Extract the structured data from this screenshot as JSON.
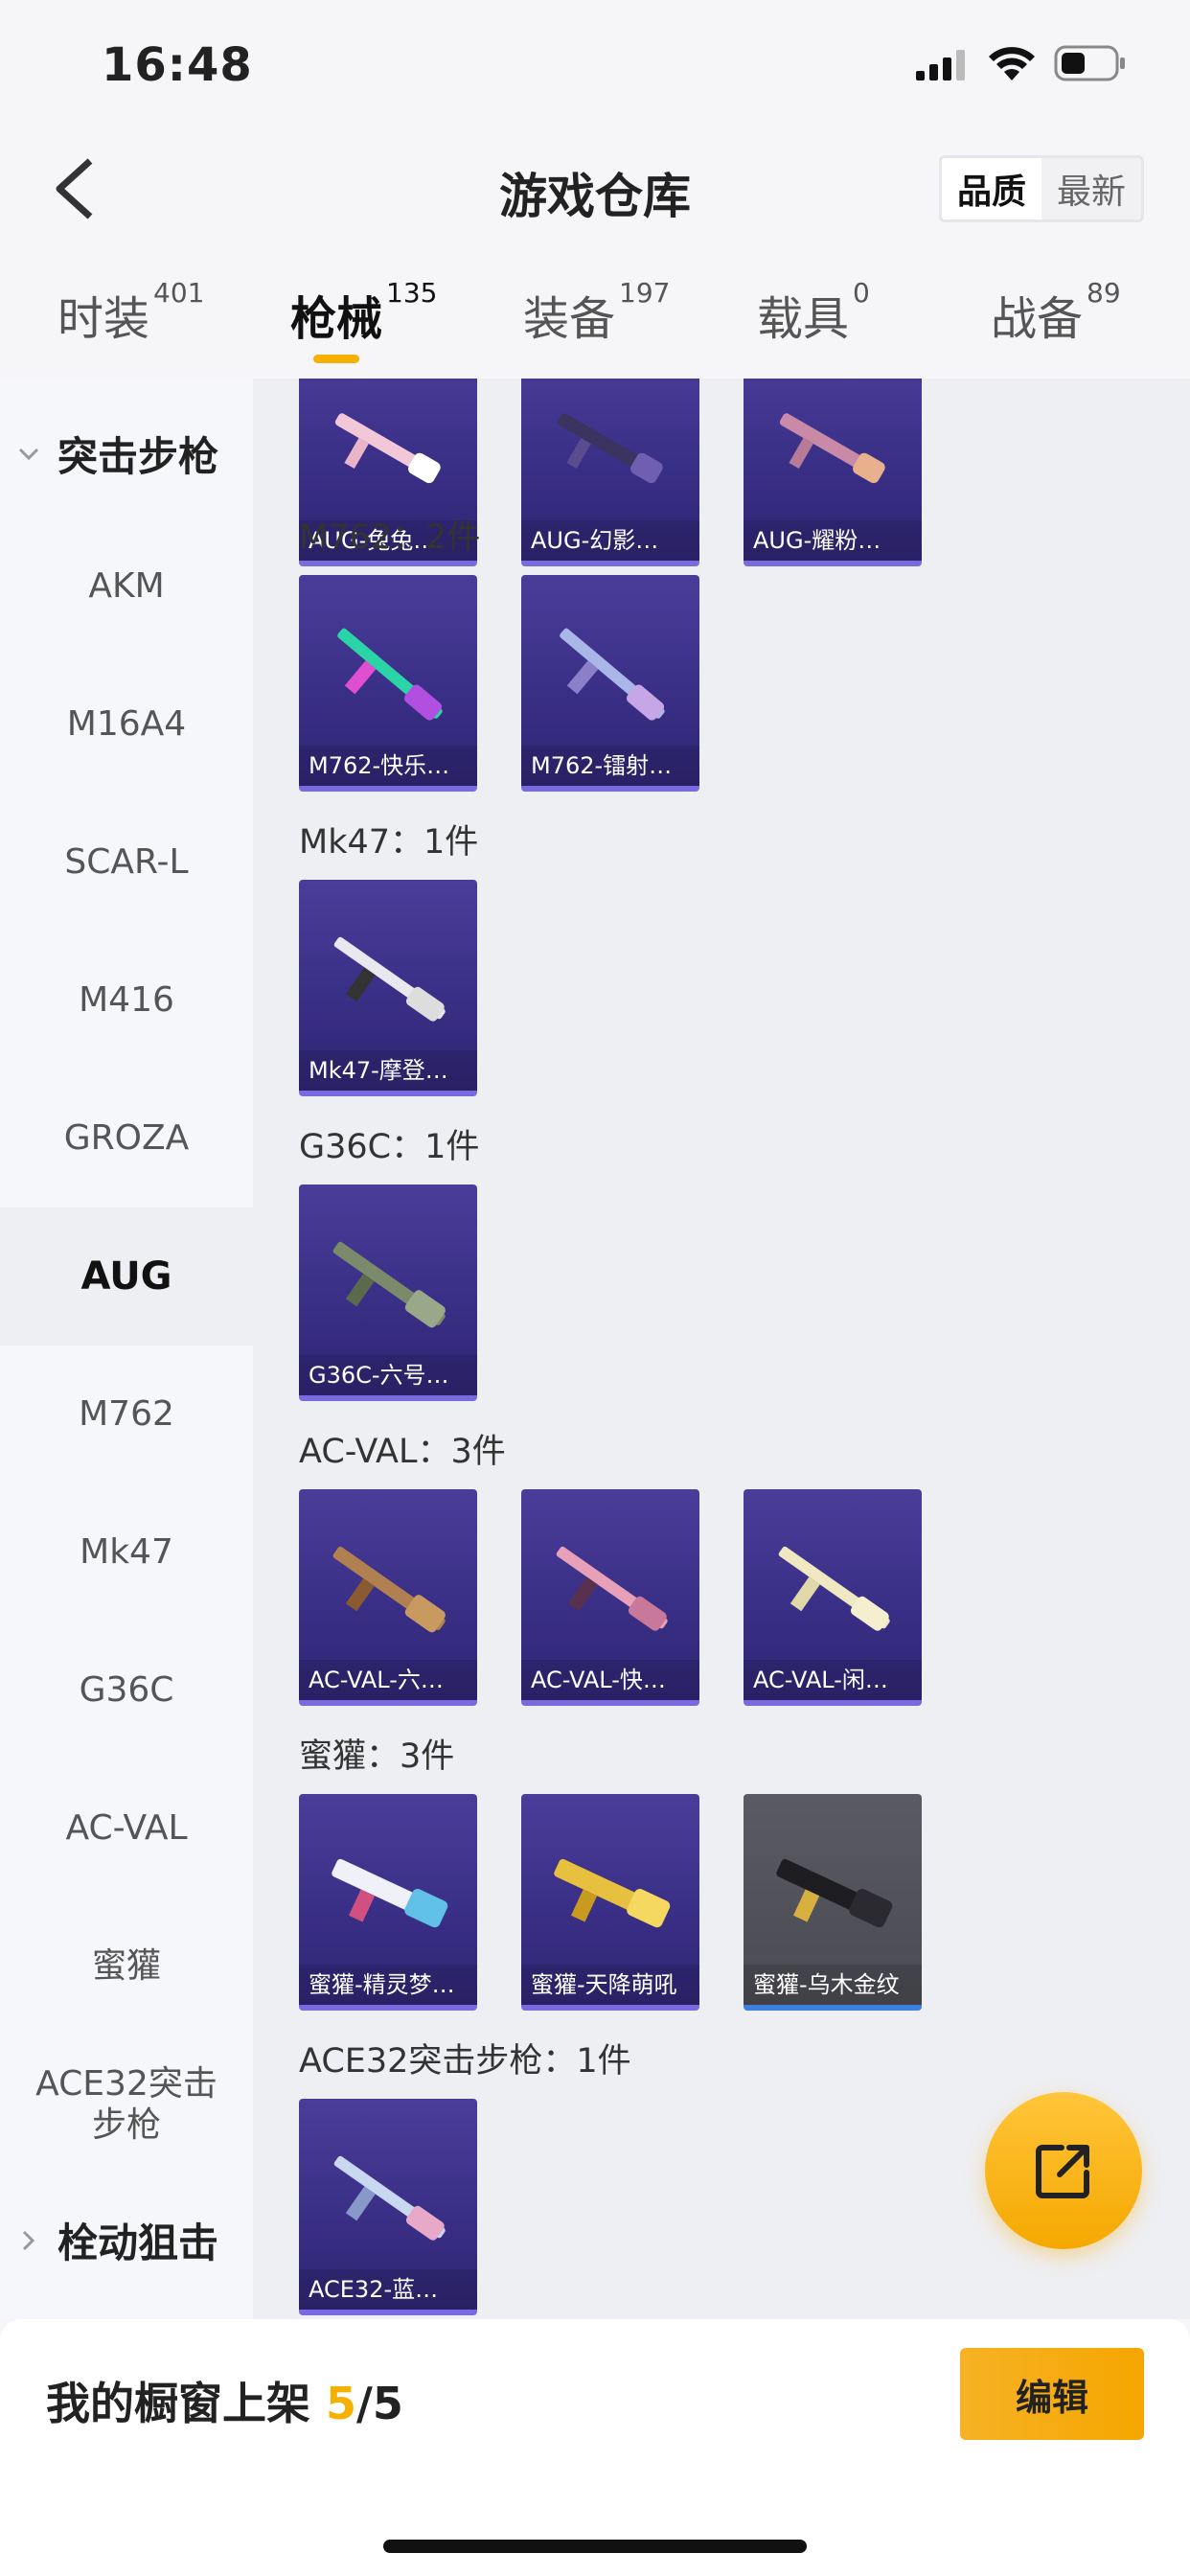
{
  "status": {
    "time": "16:48"
  },
  "header": {
    "title": "游戏仓库",
    "sort_quality": "品质",
    "sort_newest": "最新"
  },
  "tabs": [
    {
      "label": "时装",
      "count": "401"
    },
    {
      "label": "枪械",
      "count": "135"
    },
    {
      "label": "装备",
      "count": "197"
    },
    {
      "label": "载具",
      "count": "0"
    },
    {
      "label": "战备",
      "count": "89"
    }
  ],
  "sidebar": {
    "category_open": "突击步枪",
    "category_closed": "栓动狙击",
    "items": [
      "AKM",
      "M16A4",
      "SCAR-L",
      "M416",
      "GROZA",
      "AUG",
      "M762",
      "Mk47",
      "G36C",
      "AC-VAL",
      "蜜獾",
      "ACE32突击步枪"
    ],
    "selected": "AUG"
  },
  "groups": [
    {
      "label": "",
      "items": [
        "AUG-兔兔…",
        "AUG-幻影…",
        "AUG-耀粉…"
      ]
    },
    {
      "label": "M762：2件",
      "items": [
        "M762-快乐…",
        "M762-镭射…"
      ]
    },
    {
      "label": "Mk47：1件",
      "items": [
        "Mk47-摩登…"
      ]
    },
    {
      "label": "G36C：1件",
      "items": [
        "G36C-六号…"
      ]
    },
    {
      "label": "AC-VAL：3件",
      "items": [
        "AC-VAL-六…",
        "AC-VAL-快…",
        "AC-VAL-闲…"
      ]
    },
    {
      "label": "蜜獾：3件",
      "items": [
        "蜜獾-精灵梦…",
        "蜜獾-天降萌吼",
        "蜜獾-乌木金纹"
      ]
    },
    {
      "label": "ACE32突击步枪：1件",
      "items": [
        "ACE32-蓝…"
      ]
    }
  ],
  "bottom": {
    "shelf_label": "我的橱窗上架",
    "shelf_current": "5",
    "shelf_total": "/5",
    "edit_label": "编辑"
  },
  "colors": {
    "accent": "#f5b000",
    "card_purple": "#3a2f86",
    "card_grey": "#4f4f58"
  }
}
